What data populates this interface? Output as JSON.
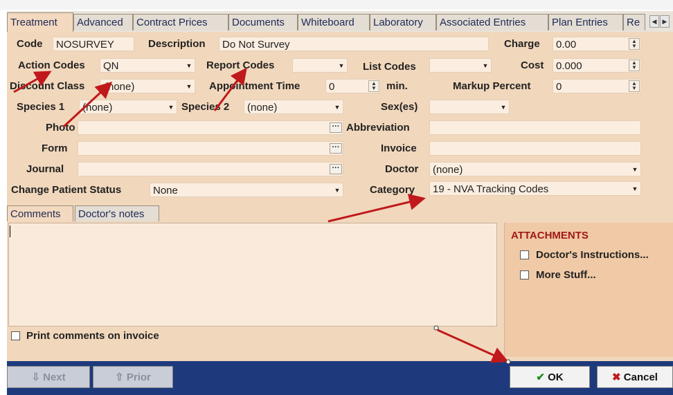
{
  "tabs": [
    "Treatment",
    "Advanced",
    "Contract Prices",
    "Documents",
    "Whiteboard",
    "Laboratory",
    "Associated Entries",
    "Plan Entries",
    "Re"
  ],
  "form": {
    "code_label": "Code",
    "code_value": "NOSURVEY",
    "description_label": "Description",
    "description_value": "Do Not Survey",
    "charge_label": "Charge",
    "charge_value": "0.00",
    "action_codes_label": "Action Codes",
    "action_codes_value": "QN",
    "report_codes_label": "Report Codes",
    "report_codes_value": "",
    "list_codes_label": "List Codes",
    "list_codes_value": "",
    "cost_label": "Cost",
    "cost_value": "0.000",
    "discount_class_label": "Discount Class",
    "discount_class_value": "(none)",
    "appointment_time_label": "Appointment Time",
    "appointment_time_value": "0",
    "min_label": "min.",
    "markup_percent_label": "Markup Percent",
    "markup_percent_value": "0",
    "species1_label": "Species 1",
    "species1_value": "(none)",
    "species2_label": "Species 2",
    "species2_value": "(none)",
    "sexes_label": "Sex(es)",
    "sexes_value": "",
    "photo_label": "Photo",
    "photo_value": "",
    "abbreviation_label": "Abbreviation",
    "abbreviation_value": "",
    "form_label": "Form",
    "form_value": "",
    "invoice_label": "Invoice",
    "invoice_value": "",
    "journal_label": "Journal",
    "journal_value": "",
    "doctor_label": "Doctor",
    "doctor_value": "(none)",
    "change_status_label": "Change Patient Status",
    "change_status_value": "None",
    "category_label": "Category",
    "category_value": "19 - NVA Tracking Codes"
  },
  "subtabs": [
    "Comments",
    "Doctor's notes"
  ],
  "print_comments_label": "Print comments on invoice",
  "attachments": {
    "title": "ATTACHMENTS",
    "items": [
      "Doctor's Instructions...",
      "More Stuff..."
    ]
  },
  "buttons": {
    "next": "Next",
    "prior": "Prior",
    "ok": "OK",
    "cancel": "Cancel"
  },
  "colors": {
    "panel": "#f1d7bc",
    "bottom_bar": "#1e3a7d",
    "annotation_arrow": "#c0191b",
    "attachments_title": "#a01818"
  }
}
